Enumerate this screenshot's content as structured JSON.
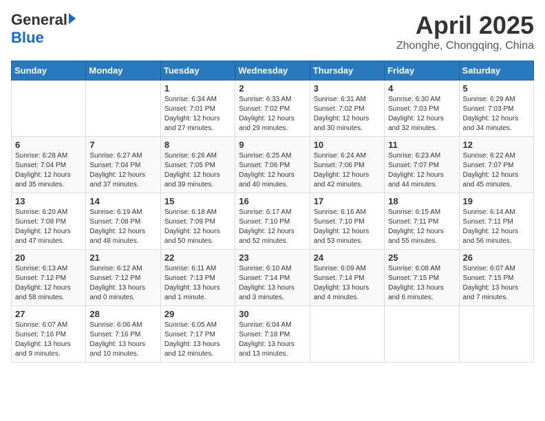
{
  "header": {
    "logo_general": "General",
    "logo_blue": "Blue",
    "month_title": "April 2025",
    "location": "Zhonghe, Chongqing, China"
  },
  "weekdays": [
    "Sunday",
    "Monday",
    "Tuesday",
    "Wednesday",
    "Thursday",
    "Friday",
    "Saturday"
  ],
  "weeks": [
    [
      {
        "day": "",
        "info": ""
      },
      {
        "day": "",
        "info": ""
      },
      {
        "day": "1",
        "info": "Sunrise: 6:34 AM\nSunset: 7:01 PM\nDaylight: 12 hours and 27 minutes."
      },
      {
        "day": "2",
        "info": "Sunrise: 6:33 AM\nSunset: 7:02 PM\nDaylight: 12 hours and 29 minutes."
      },
      {
        "day": "3",
        "info": "Sunrise: 6:31 AM\nSunset: 7:02 PM\nDaylight: 12 hours and 30 minutes."
      },
      {
        "day": "4",
        "info": "Sunrise: 6:30 AM\nSunset: 7:03 PM\nDaylight: 12 hours and 32 minutes."
      },
      {
        "day": "5",
        "info": "Sunrise: 6:29 AM\nSunset: 7:03 PM\nDaylight: 12 hours and 34 minutes."
      }
    ],
    [
      {
        "day": "6",
        "info": "Sunrise: 6:28 AM\nSunset: 7:04 PM\nDaylight: 12 hours and 35 minutes."
      },
      {
        "day": "7",
        "info": "Sunrise: 6:27 AM\nSunset: 7:04 PM\nDaylight: 12 hours and 37 minutes."
      },
      {
        "day": "8",
        "info": "Sunrise: 6:26 AM\nSunset: 7:05 PM\nDaylight: 12 hours and 39 minutes."
      },
      {
        "day": "9",
        "info": "Sunrise: 6:25 AM\nSunset: 7:06 PM\nDaylight: 12 hours and 40 minutes."
      },
      {
        "day": "10",
        "info": "Sunrise: 6:24 AM\nSunset: 7:06 PM\nDaylight: 12 hours and 42 minutes."
      },
      {
        "day": "11",
        "info": "Sunrise: 6:23 AM\nSunset: 7:07 PM\nDaylight: 12 hours and 44 minutes."
      },
      {
        "day": "12",
        "info": "Sunrise: 6:22 AM\nSunset: 7:07 PM\nDaylight: 12 hours and 45 minutes."
      }
    ],
    [
      {
        "day": "13",
        "info": "Sunrise: 6:20 AM\nSunset: 7:08 PM\nDaylight: 12 hours and 47 minutes."
      },
      {
        "day": "14",
        "info": "Sunrise: 6:19 AM\nSunset: 7:08 PM\nDaylight: 12 hours and 48 minutes."
      },
      {
        "day": "15",
        "info": "Sunrise: 6:18 AM\nSunset: 7:09 PM\nDaylight: 12 hours and 50 minutes."
      },
      {
        "day": "16",
        "info": "Sunrise: 6:17 AM\nSunset: 7:10 PM\nDaylight: 12 hours and 52 minutes."
      },
      {
        "day": "17",
        "info": "Sunrise: 6:16 AM\nSunset: 7:10 PM\nDaylight: 12 hours and 53 minutes."
      },
      {
        "day": "18",
        "info": "Sunrise: 6:15 AM\nSunset: 7:11 PM\nDaylight: 12 hours and 55 minutes."
      },
      {
        "day": "19",
        "info": "Sunrise: 6:14 AM\nSunset: 7:11 PM\nDaylight: 12 hours and 56 minutes."
      }
    ],
    [
      {
        "day": "20",
        "info": "Sunrise: 6:13 AM\nSunset: 7:12 PM\nDaylight: 12 hours and 58 minutes."
      },
      {
        "day": "21",
        "info": "Sunrise: 6:12 AM\nSunset: 7:12 PM\nDaylight: 13 hours and 0 minutes."
      },
      {
        "day": "22",
        "info": "Sunrise: 6:11 AM\nSunset: 7:13 PM\nDaylight: 13 hours and 1 minute."
      },
      {
        "day": "23",
        "info": "Sunrise: 6:10 AM\nSunset: 7:14 PM\nDaylight: 13 hours and 3 minutes."
      },
      {
        "day": "24",
        "info": "Sunrise: 6:09 AM\nSunset: 7:14 PM\nDaylight: 13 hours and 4 minutes."
      },
      {
        "day": "25",
        "info": "Sunrise: 6:08 AM\nSunset: 7:15 PM\nDaylight: 13 hours and 6 minutes."
      },
      {
        "day": "26",
        "info": "Sunrise: 6:07 AM\nSunset: 7:15 PM\nDaylight: 13 hours and 7 minutes."
      }
    ],
    [
      {
        "day": "27",
        "info": "Sunrise: 6:07 AM\nSunset: 7:16 PM\nDaylight: 13 hours and 9 minutes."
      },
      {
        "day": "28",
        "info": "Sunrise: 6:06 AM\nSunset: 7:16 PM\nDaylight: 13 hours and 10 minutes."
      },
      {
        "day": "29",
        "info": "Sunrise: 6:05 AM\nSunset: 7:17 PM\nDaylight: 13 hours and 12 minutes."
      },
      {
        "day": "30",
        "info": "Sunrise: 6:04 AM\nSunset: 7:18 PM\nDaylight: 13 hours and 13 minutes."
      },
      {
        "day": "",
        "info": ""
      },
      {
        "day": "",
        "info": ""
      },
      {
        "day": "",
        "info": ""
      }
    ]
  ]
}
